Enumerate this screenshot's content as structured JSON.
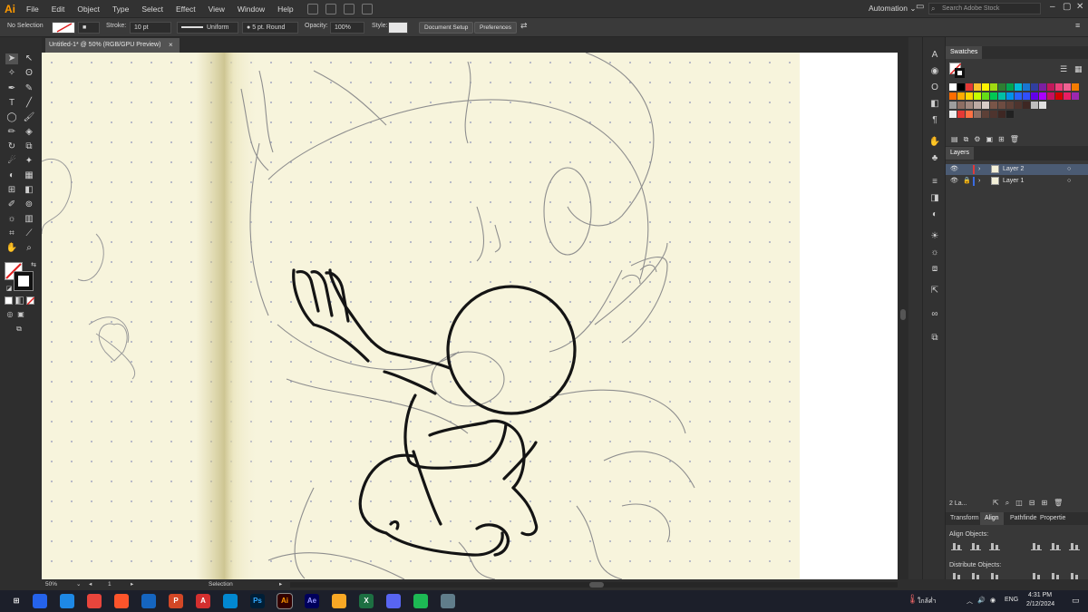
{
  "app": {
    "logo": "Ai",
    "accent": "#ff9a00"
  },
  "menu": [
    "File",
    "Edit",
    "Object",
    "Type",
    "Select",
    "Effect",
    "View",
    "Window",
    "Help"
  ],
  "workspace": {
    "label": "Automation ⌄",
    "search_placeholder": "Search Adobe Stock"
  },
  "control_bar": {
    "selection": "No Selection",
    "stroke_label": "Stroke:",
    "stroke_value": "10 pt",
    "profile": "Uniform",
    "brush": "5 pt. Round",
    "opacity_label": "Opacity:",
    "opacity_value": "100%",
    "style_label": "Style:",
    "document_setup": "Document Setup",
    "preferences": "Preferences"
  },
  "document": {
    "tab_title": "Untitled-1* @ 50% (RGB/GPU Preview)",
    "close": "×"
  },
  "panels": {
    "swatches_title": "Swatches",
    "layers_title": "Layers",
    "layers": [
      {
        "name": "Layer 2",
        "color": "#e03a3a",
        "selected": true
      },
      {
        "name": "Layer 1",
        "color": "#3a6be0",
        "selected": false
      }
    ],
    "layers_count": "2 La...",
    "tabs": [
      "Transform",
      "Align",
      "Pathfinde",
      "Propertie"
    ],
    "align_objects": "Align Objects:",
    "distribute_objects": "Distribute Objects:"
  },
  "swatch_rows": [
    [
      "#ffffff",
      "#000000",
      "#e53935",
      "#fbc02d",
      "#fff200",
      "#a0d911",
      "#2e7d32",
      "#00a651",
      "#00bcd4",
      "#1976d2",
      "#303f9f",
      "#7b1fa2",
      "#c2185b",
      "#ec407a",
      "#f06292",
      "#f57c00"
    ],
    [
      "#ff6d00",
      "#ffab00",
      "#ffd600",
      "#c6ff00",
      "#64dd17",
      "#00c853",
      "#00bfa5",
      "#0091ea",
      "#2962ff",
      "#304ffe",
      "#6200ea",
      "#aa00ff",
      "#c51162",
      "#d50000",
      "#e91e63",
      "#9c27b0"
    ],
    [
      "#9e9e9e",
      "#8d6e63",
      "#a1887f",
      "#bcaaa4",
      "#d7ccc8",
      "#795548",
      "#6d4c41",
      "#5d4037",
      "#4e342e",
      "#3e2723",
      "#bdbdbd",
      "#e0e0e0"
    ],
    [
      "#eeeeee",
      "#e53935",
      "#ff7043",
      "#8d6e63",
      "#5d4037",
      "#4e342e",
      "#3e2723",
      "#212121"
    ]
  ],
  "status": {
    "zoom": "50%",
    "artboard": "1",
    "tool": "Selection"
  },
  "taskbar": {
    "apps": [
      {
        "label": "⊞",
        "color": "#00000000"
      },
      {
        "label": "",
        "color": "#2563eb"
      },
      {
        "label": "",
        "color": "#1e88e5"
      },
      {
        "label": "",
        "color": "#e8453c"
      },
      {
        "label": "",
        "color": "#fb542b"
      },
      {
        "label": "",
        "color": "#1565c0"
      },
      {
        "label": "P",
        "color": "#d24726"
      },
      {
        "label": "A",
        "color": "#d32f2f"
      },
      {
        "label": "",
        "color": "#0288d1"
      },
      {
        "label": "Ps",
        "color": "#001e36"
      },
      {
        "label": "Ai",
        "color": "#330000"
      },
      {
        "label": "Ae",
        "color": "#00005b"
      },
      {
        "label": "",
        "color": "#f9a825"
      },
      {
        "label": "X",
        "color": "#1d6f42"
      },
      {
        "label": "",
        "color": "#5865f2"
      },
      {
        "label": "",
        "color": "#1db954"
      },
      {
        "label": "",
        "color": "#607d8b"
      }
    ],
    "weather": "ใกล้ค่ำ",
    "language": "ENG",
    "time": "4:31 PM",
    "date": "2/12/2024"
  }
}
